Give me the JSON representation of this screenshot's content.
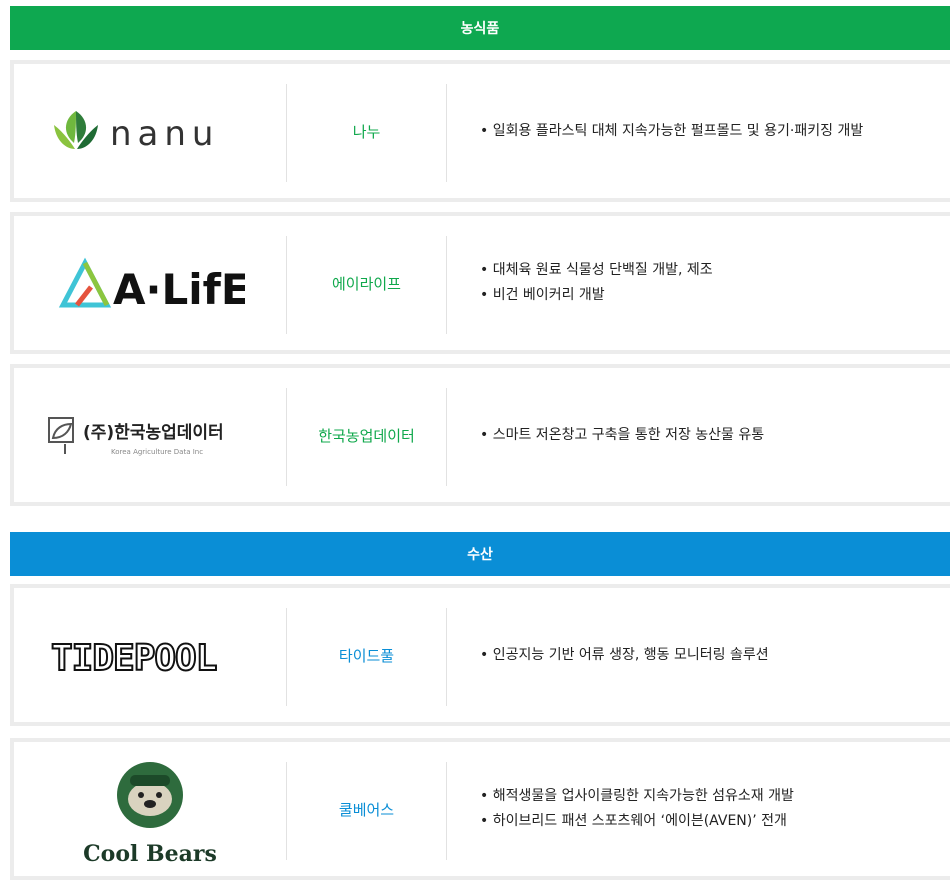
{
  "sections": {
    "agri_title": "농식품",
    "fish_title": "수산"
  },
  "companies": [
    {
      "logo_text": "nanu",
      "name": "나누",
      "items": [
        "일회용 플라스틱 대체 지속가능한 펄프몰드 및 용기·패키징 개발"
      ]
    },
    {
      "logo_text": "A·LifE",
      "name": "에이라이프",
      "items": [
        "대체육 원료 식물성 단백질 개발, 제조",
        "비건 베이커리 개발"
      ]
    },
    {
      "logo_text": "(주)한국농업데이터",
      "logo_sub": "Korea Agriculture Data Inc",
      "name": "한국농업데이터",
      "items": [
        "스마트 저온창고 구축을 통한 저장 농산물 유통"
      ]
    },
    {
      "logo_text": "TIDEPOOL",
      "name": "타이드풀",
      "items": [
        "인공지능 기반 어류 생장, 행동 모니터링 솔루션"
      ]
    },
    {
      "logo_text": "Cool Bears",
      "name": "쿨베어스",
      "items": [
        "해적생물을 업사이클링한 지속가능한 섬유소재 개발",
        "하이브리드 패션 스포츠웨어 ‘에이븐(AVEN)’ 전개"
      ]
    }
  ],
  "colors": {
    "agri_band": "#0ea850",
    "fish_band": "#0a8ed6",
    "agri_name": "#10a84c",
    "fish_name": "#0a8ed6"
  }
}
